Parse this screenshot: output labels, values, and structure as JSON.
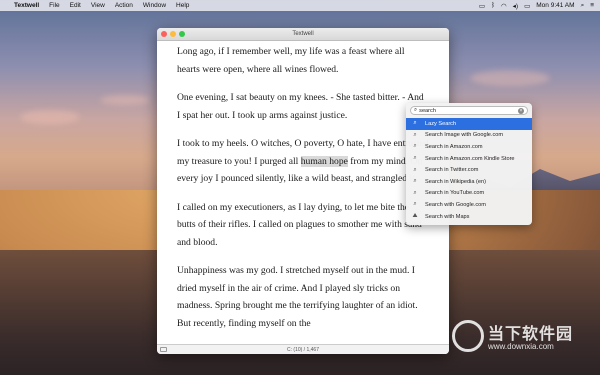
{
  "menubar": {
    "apple_icon": "apple-icon",
    "app": "Textwell",
    "items": [
      "File",
      "Edit",
      "View",
      "Action",
      "Window",
      "Help"
    ],
    "clock": "Mon 9:41 AM"
  },
  "window": {
    "title": "Textwell",
    "paragraphs": [
      {
        "pre": "Long ago, if I remember well, my life was a feast where all hearts were open, where all wines flowed.",
        "hl": "",
        "post": ""
      },
      {
        "pre": "One evening, I sat beauty on my knees. - She tasted bitter. - And I spat her out. I took up arms against justice.",
        "hl": "",
        "post": ""
      },
      {
        "pre": "I took to my heels. O witches, O poverty, O hate, I have entrusted my treasure to you! I purged all ",
        "hl": "human hope",
        "post": " from my mind. On every joy I pounced silently, like a wild beast, and strangled it."
      },
      {
        "pre": "I called on my executioners, as I lay dying, to let me bite the butts of their rifles. I called on plagues to smother me with sand and blood.",
        "hl": "",
        "post": ""
      },
      {
        "pre": "Unhappiness was my god. I stretched myself out in the mud. I dried myself in the air of crime. And I played sly tricks on madness. Spring brought me the terrifying laughter of an idiot. But recently, finding myself on the",
        "hl": "",
        "post": ""
      }
    ],
    "status": "C: (10) / 1,467"
  },
  "popup": {
    "search_value": "search",
    "items": [
      {
        "label": "Lazy Search",
        "icon": "search-icon"
      },
      {
        "label": "Search Image with Google.com",
        "icon": "search-icon"
      },
      {
        "label": "Search in Amazon.com",
        "icon": "search-icon"
      },
      {
        "label": "Search in Amazon.com Kindle Store",
        "icon": "search-icon"
      },
      {
        "label": "Search in Twitter.com",
        "icon": "search-icon"
      },
      {
        "label": "Search in Wikipedia (en)",
        "icon": "search-icon"
      },
      {
        "label": "Search in YouTube.com",
        "icon": "search-icon"
      },
      {
        "label": "Search with Google.com",
        "icon": "search-icon"
      },
      {
        "label": "Search with Maps",
        "icon": "map-icon"
      }
    ],
    "selected_index": 0
  },
  "watermark": {
    "title": "当下软件园",
    "url": "www.downxia.com"
  },
  "colors": {
    "accent": "#2c6fe0",
    "close": "#fc605c",
    "minimize": "#fdbc40",
    "maximize": "#34c84a"
  }
}
